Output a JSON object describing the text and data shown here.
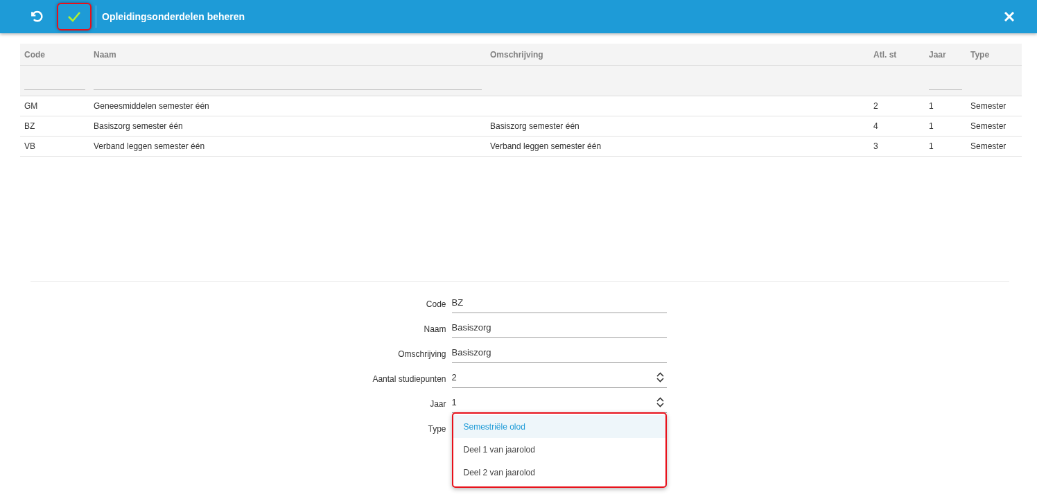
{
  "header": {
    "title": "Opleidingsonderdelen beheren",
    "buttons": [
      {
        "kind": "undo",
        "highlighted": false
      },
      {
        "kind": "confirm",
        "highlighted": true
      }
    ]
  },
  "table": {
    "columns": [
      {
        "label": "Code",
        "filter": true
      },
      {
        "label": "Naam",
        "filter": true
      },
      {
        "label": "Omschrijving",
        "filter": false
      },
      {
        "label": "Atl. st",
        "filter": false
      },
      {
        "label": "Jaar",
        "filter": true
      },
      {
        "label": "Type",
        "filter": false
      }
    ],
    "rows": [
      [
        "GM",
        "Geneesmiddelen semester één",
        "",
        "2",
        "1",
        "Semester"
      ],
      [
        "BZ",
        "Basiszorg semester één",
        "Basiszorg semester één",
        "4",
        "1",
        "Semester"
      ],
      [
        "VB",
        "Verband leggen semester één",
        "Verband leggen semester één",
        "3",
        "1",
        "Semester"
      ]
    ]
  },
  "form": {
    "fields": [
      {
        "label": "Code",
        "kind": "text",
        "value": "BZ"
      },
      {
        "label": "Naam",
        "kind": "text",
        "value": "Basiszorg"
      },
      {
        "label": "Omschrijving",
        "kind": "text",
        "value": "Basiszorg"
      },
      {
        "label": "Aantal studiepunten",
        "kind": "number",
        "value": "2"
      },
      {
        "label": "Jaar",
        "kind": "number",
        "value": "1"
      },
      {
        "label": "Type",
        "kind": "select",
        "highlighted": true,
        "options": [
          {
            "label": "Semestriële olod",
            "selected": true
          },
          {
            "label": "Deel 1 van jaarolod",
            "selected": false
          },
          {
            "label": "Deel 2 van jaarolod",
            "selected": false
          }
        ]
      }
    ]
  }
}
